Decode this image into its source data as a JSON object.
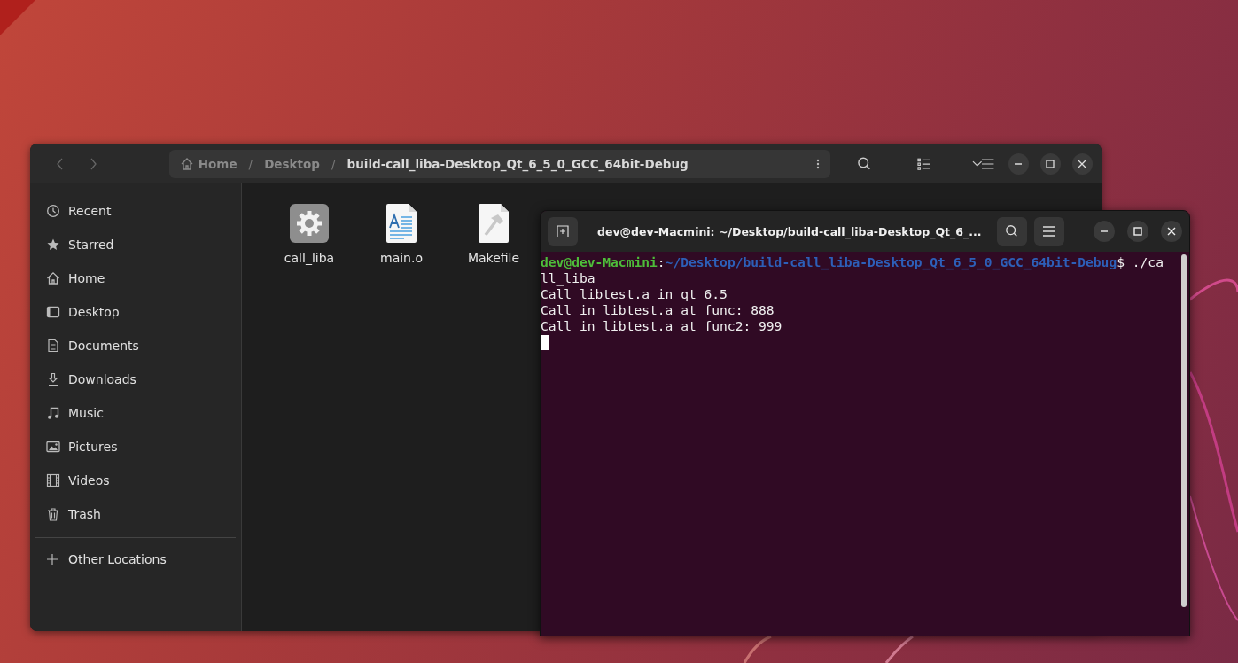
{
  "files_window": {
    "path_separator": "/",
    "breadcrumbs": [
      {
        "label": "Home",
        "kind": "home",
        "selected": false
      },
      {
        "label": "Desktop",
        "kind": "folder",
        "selected": false
      },
      {
        "label": "build-call_liba-Desktop_Qt_6_5_0_GCC_64bit-Debug",
        "kind": "folder",
        "selected": true
      }
    ],
    "sidebar": {
      "items": [
        {
          "label": "Recent",
          "kind": "recent"
        },
        {
          "label": "Starred",
          "kind": "starred"
        },
        {
          "label": "Home",
          "kind": "home"
        },
        {
          "label": "Desktop",
          "kind": "desktop"
        },
        {
          "label": "Documents",
          "kind": "documents"
        },
        {
          "label": "Downloads",
          "kind": "downloads"
        },
        {
          "label": "Music",
          "kind": "music"
        },
        {
          "label": "Pictures",
          "kind": "pictures"
        },
        {
          "label": "Videos",
          "kind": "videos"
        },
        {
          "label": "Trash",
          "kind": "trash"
        }
      ],
      "other": {
        "label": "Other Locations"
      }
    },
    "files": [
      {
        "name": "call_liba",
        "kind": "executable"
      },
      {
        "name": "main.o",
        "kind": "text"
      },
      {
        "name": "Makefile",
        "kind": "makefile"
      }
    ]
  },
  "terminal": {
    "title": "dev@dev-Macmini: ~/Desktop/build-call_liba-Desktop_Qt_6_...",
    "prompt": {
      "user": "dev@dev-Macmini",
      "separator": ":",
      "path": "~/Desktop/build-call_liba-Desktop_Qt_6_5_0_GCC_64bit-Debug",
      "symbol": "$",
      "command": "./ca"
    },
    "output": [
      "ll_liba",
      "Call libtest.a in qt 6.5",
      "Call in libtest.a at func: 888",
      "Call in libtest.a at func2: 999"
    ]
  }
}
